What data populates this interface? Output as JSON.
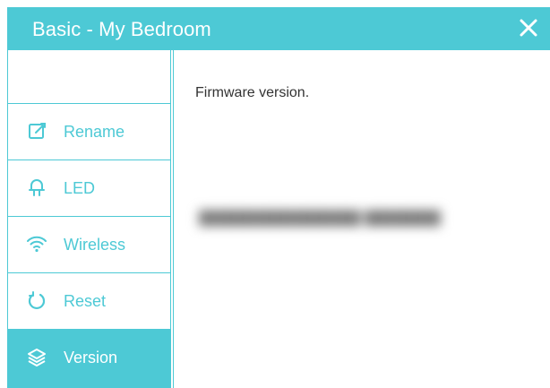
{
  "dialog": {
    "title": "Basic - My Bedroom",
    "close_icon": "close-icon"
  },
  "sidebar": {
    "items": [
      {
        "label": "Rename",
        "icon": "edit-icon",
        "active": false
      },
      {
        "label": "LED",
        "icon": "led-icon",
        "active": false
      },
      {
        "label": "Wireless",
        "icon": "wifi-icon",
        "active": false
      },
      {
        "label": "Reset",
        "icon": "reset-icon",
        "active": false
      },
      {
        "label": "Version",
        "icon": "layers-icon",
        "active": true
      }
    ]
  },
  "content": {
    "heading": "Firmware version.",
    "value_redacted": true
  },
  "colors": {
    "accent": "#4dc9d5",
    "text": "#333333",
    "background": "#ffffff"
  }
}
